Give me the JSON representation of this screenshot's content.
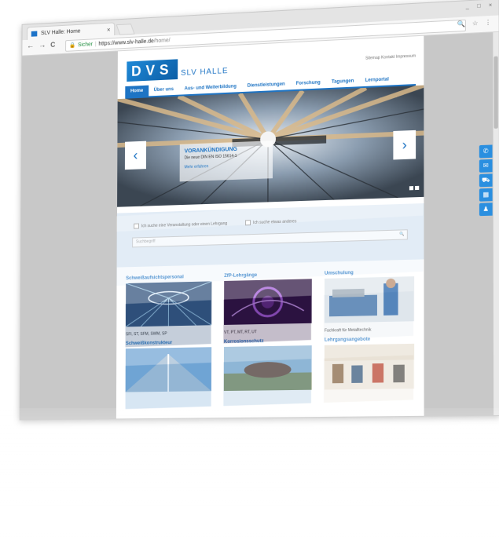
{
  "browser": {
    "tab_title": "SLV Halle: Home",
    "tab_close": "×",
    "window_controls": "_ □ ×",
    "nav_back": "←",
    "nav_forward": "→",
    "nav_reload": "C",
    "secure_label": "Sicher",
    "url_host": "https://www.slv-halle.de",
    "url_path": "/home/",
    "toolbar_icons": "🔍 ☆ ⋮"
  },
  "site": {
    "logo_text": "DVS",
    "logo_sub": "SLV HALLE",
    "meta_links": "Sitemap  Kontakt  Impressum",
    "nav": [
      {
        "label": "Home"
      },
      {
        "label": "Über uns"
      },
      {
        "label": "Aus- und Weiterbildung"
      },
      {
        "label": "Dienstleistungen"
      },
      {
        "label": "Forschung"
      },
      {
        "label": "Tagungen"
      },
      {
        "label": "Lernportal"
      }
    ],
    "hero": {
      "prev": "‹",
      "next": "›",
      "title": "VORANKÜNDIGUNG",
      "subtitle": "Die neue DIN EN ISO 15614-1",
      "link": "Mehr erfahren"
    },
    "search": {
      "option1": "Ich suche eine Veranstaltung oder einen Lehrgang",
      "option2": "Ich suche etwas anderes",
      "placeholder": "Suchbegriff",
      "icon": "🔍"
    },
    "tiles": [
      {
        "title": "Schweißaufsichtspersonal",
        "caption": "SFI, ST, SFM, SWM, SP"
      },
      {
        "title": "ZfP-Lehrgänge",
        "caption": "VT, PT, MT, RT, UT"
      },
      {
        "title": "Umschulung",
        "caption": "Fachkraft für Metalltechnik"
      },
      {
        "title": "Schweißkonstrukteur",
        "caption": ""
      },
      {
        "title": "Korrosionsschutz",
        "caption": ""
      },
      {
        "title": "Lehrgangsangebote",
        "caption": ""
      }
    ],
    "side_icons": [
      "phone-icon",
      "mail-icon",
      "car-icon",
      "calendar-icon",
      "user-icon"
    ]
  },
  "colors": {
    "brand": "#1e74c4",
    "accent": "#2a8fe0"
  }
}
